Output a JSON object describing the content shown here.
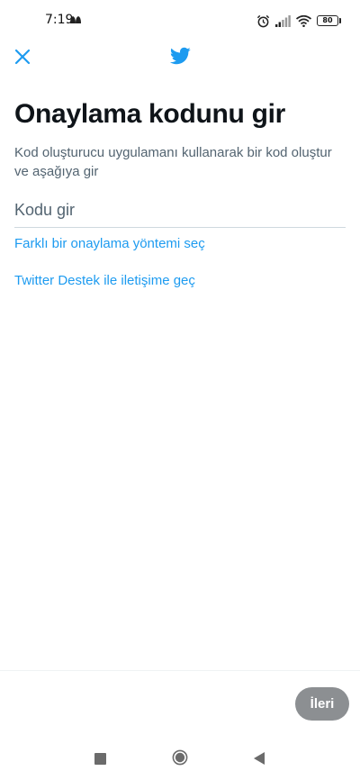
{
  "status_bar": {
    "time": "7:19",
    "battery_level": "80",
    "icons": [
      "notification-app-icon",
      "alarm-icon",
      "signal-icon",
      "wifi-icon",
      "battery-icon"
    ]
  },
  "header": {
    "close_icon": "close-icon",
    "logo_icon": "twitter-bird-icon",
    "accent_color": "#1d9bf0"
  },
  "content": {
    "title": "Onaylama kodunu gir",
    "subtitle": "Kod oluşturucu uygulamanı kullanarak bir kod oluştur ve aşağıya gir",
    "code_input": {
      "placeholder": "Kodu gir",
      "value": ""
    },
    "alternate_method_link": "Farklı bir onaylama yöntemi seç",
    "support_link": "Twitter Destek ile iletişime geç"
  },
  "footer": {
    "next_button_label": "İleri",
    "next_button_enabled": false,
    "next_button_color": "#8c8f92"
  },
  "nav_bar": {
    "icons": [
      "recents-icon",
      "home-icon",
      "back-icon"
    ]
  }
}
